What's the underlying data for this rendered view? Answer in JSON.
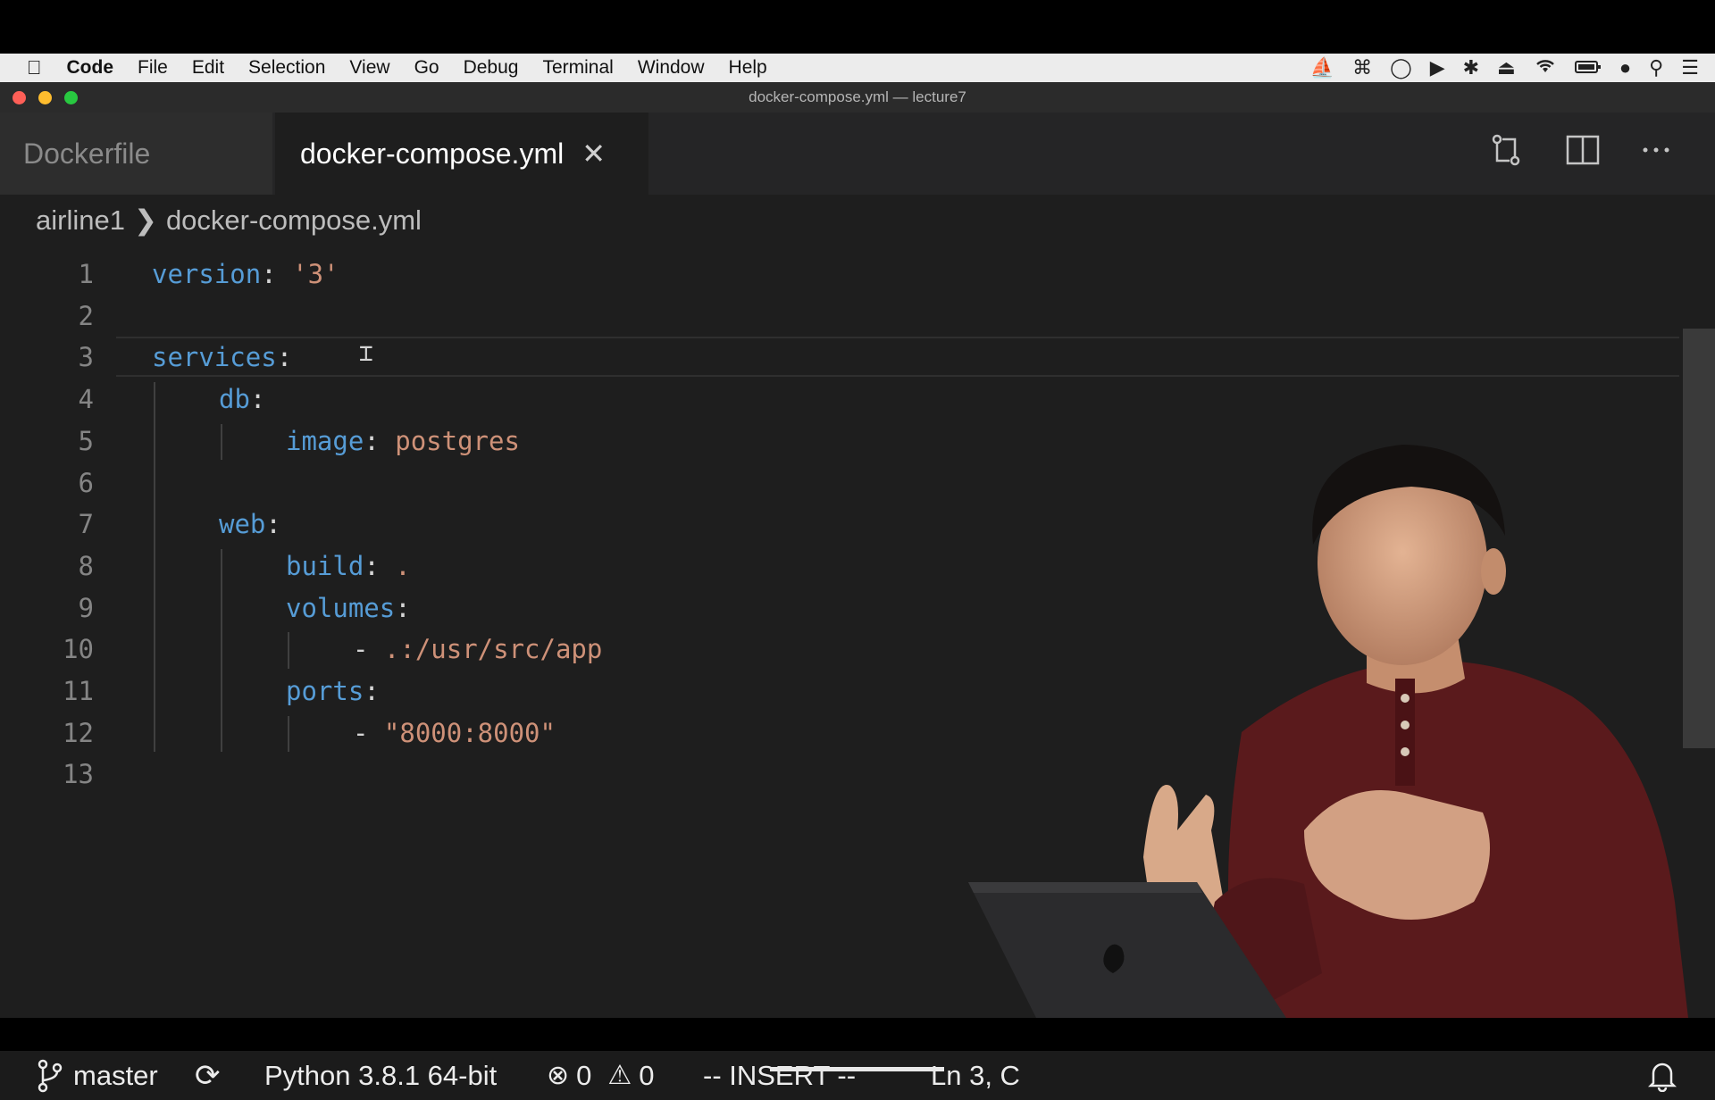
{
  "menubar": {
    "items": [
      "Code",
      "File",
      "Edit",
      "Selection",
      "View",
      "Go",
      "Debug",
      "Terminal",
      "Window",
      "Help"
    ]
  },
  "window": {
    "title": "docker-compose.yml — lecture7"
  },
  "tabs": [
    {
      "label": "Dockerfile",
      "active": false
    },
    {
      "label": "docker-compose.yml",
      "active": true
    }
  ],
  "breadcrumb": [
    "airline1",
    "docker-compose.yml"
  ],
  "editor": {
    "line_numbers": [
      "1",
      "2",
      "3",
      "4",
      "5",
      "6",
      "7",
      "8",
      "9",
      "10",
      "11",
      "12",
      "13"
    ],
    "lines": [
      [
        {
          "t": "version",
          "c": "k"
        },
        {
          "t": ": ",
          "c": "p"
        },
        {
          "t": "'3'",
          "c": "s"
        }
      ],
      [],
      [
        {
          "t": "services",
          "c": "k"
        },
        {
          "t": ":",
          "c": "p"
        }
      ],
      [
        {
          "t": "db",
          "c": "k"
        },
        {
          "t": ":",
          "c": "p"
        }
      ],
      [
        {
          "t": "image",
          "c": "k"
        },
        {
          "t": ": ",
          "c": "p"
        },
        {
          "t": "postgres",
          "c": "s"
        }
      ],
      [],
      [
        {
          "t": "web",
          "c": "k"
        },
        {
          "t": ":",
          "c": "p"
        }
      ],
      [
        {
          "t": "build",
          "c": "k"
        },
        {
          "t": ": ",
          "c": "p"
        },
        {
          "t": ".",
          "c": "s"
        }
      ],
      [
        {
          "t": "volumes",
          "c": "k"
        },
        {
          "t": ":",
          "c": "p"
        }
      ],
      [
        {
          "t": "- ",
          "c": "p"
        },
        {
          "t": ".:/usr/src/app",
          "c": "s"
        }
      ],
      [
        {
          "t": "ports",
          "c": "k"
        },
        {
          "t": ":",
          "c": "p"
        }
      ],
      [
        {
          "t": "- ",
          "c": "p"
        },
        {
          "t": "\"8000:8000\"",
          "c": "s"
        }
      ],
      []
    ],
    "indent_levels": [
      0,
      0,
      0,
      1,
      2,
      0,
      1,
      2,
      2,
      3,
      2,
      3,
      0
    ]
  },
  "statusbar": {
    "branch": "master",
    "interpreter": "Python 3.8.1 64-bit",
    "errors": "0",
    "warnings": "0",
    "mode": "-- INSERT --",
    "position": "Ln 3, C"
  },
  "colors": {
    "keyword": "#569cd6",
    "string": "#ce9178",
    "editor_bg": "#1e1e1e"
  }
}
